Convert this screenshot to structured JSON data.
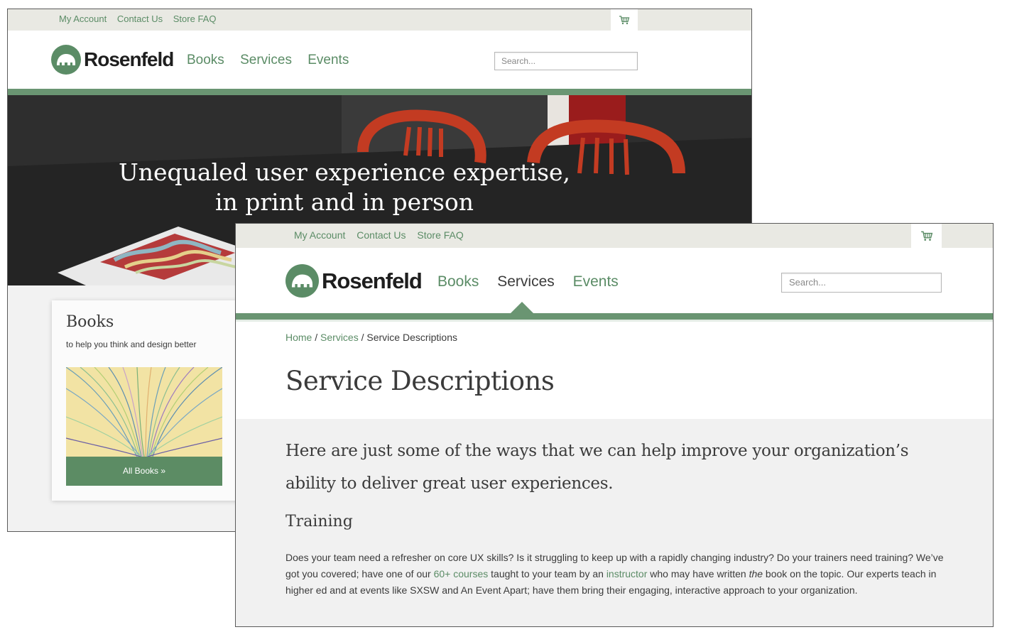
{
  "back": {
    "top_links": [
      "My Account",
      "Contact Us",
      "Store FAQ"
    ],
    "brand": "Rosenfeld",
    "nav": [
      "Books",
      "Services",
      "Events"
    ],
    "search_placeholder": "Search...",
    "hero_line1": "Unequaled user experience expertise,",
    "hero_line2": "in print and in person",
    "card": {
      "title": "Books",
      "subtitle": "to help you think and design better",
      "button": "All Books »"
    }
  },
  "front": {
    "top_links": [
      "My Account",
      "Contact Us",
      "Store FAQ"
    ],
    "brand": "Rosenfeld",
    "nav": [
      "Books",
      "Services",
      "Events"
    ],
    "active_nav": "Services",
    "search_placeholder": "Search...",
    "breadcrumb": {
      "home": "Home",
      "sep1": " / ",
      "services": "Services",
      "sep2": " / ",
      "current": "Service Descriptions"
    },
    "page_title": "Service Descriptions",
    "intro": "Here are just some of the ways that we can help improve your organization’s ability to deliver great user experiences.",
    "section_heading": "Training",
    "body": {
      "p1": "Does your team need a refresher on core UX skills? Is it struggling to keep up with a rapidly changing industry? Do your trainers need training? We’ve got you covered; have one of our ",
      "link1": "60+ courses",
      "p2": " taught to your team by an ",
      "link2": "instructor",
      "p3": " who may have written ",
      "em": "the",
      "p4": " book on the topic. Our experts teach in higher ed and at events like SXSW and An Event Apart; have them bring their engaging, interactive approach to your organization."
    }
  },
  "colors": {
    "brand_green": "#5b8c66",
    "nav_bar_green": "#6a9572",
    "top_bar": "#e9e9e3",
    "content_bg": "#f1f1f1"
  },
  "icons": [
    "cart-icon",
    "elephant-logo-icon"
  ]
}
